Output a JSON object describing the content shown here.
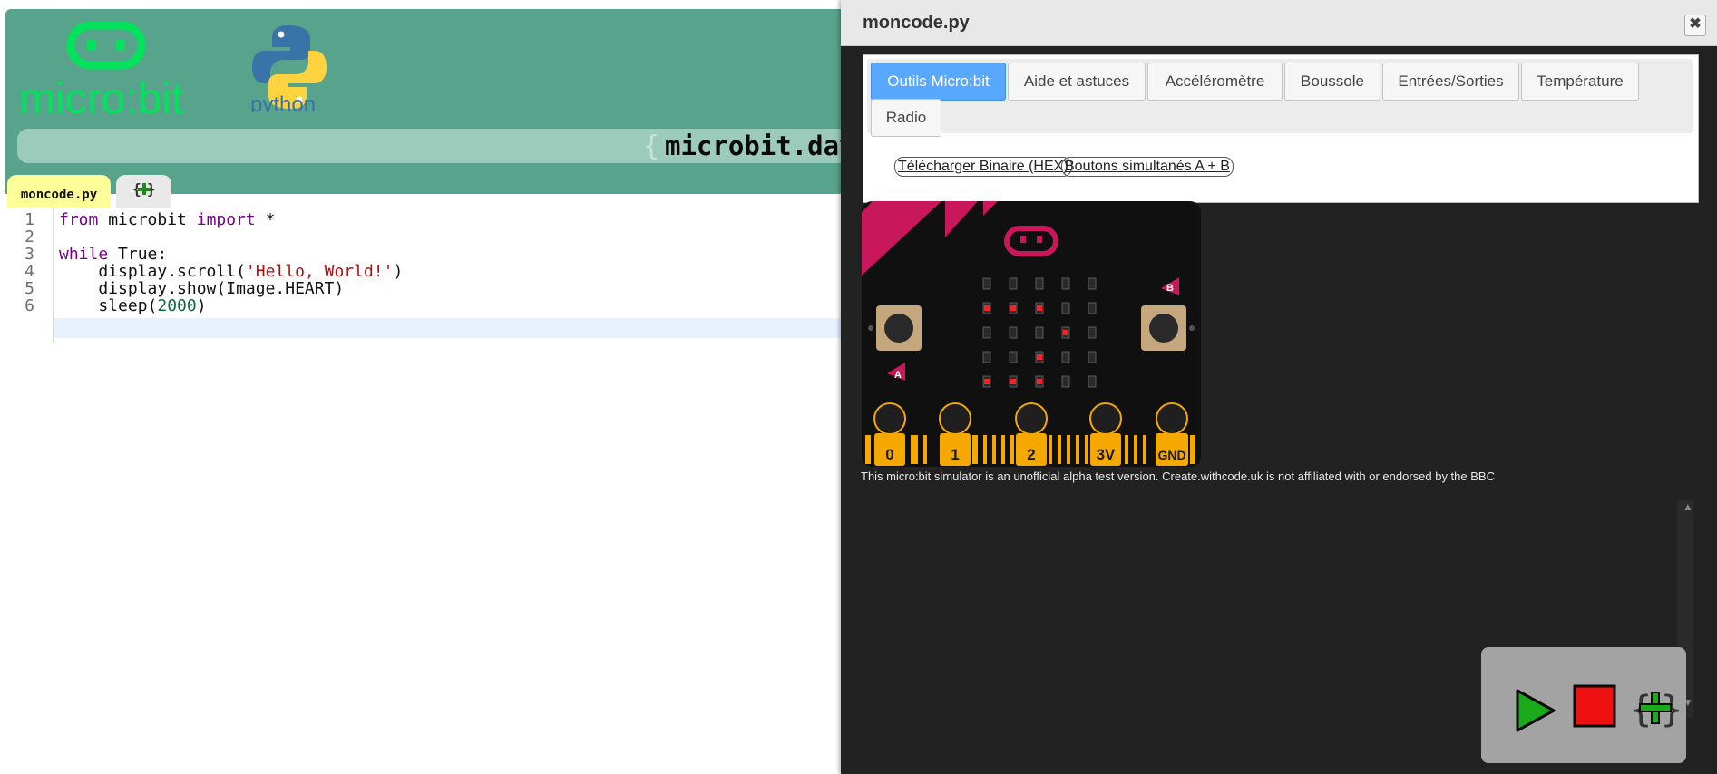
{
  "header": {
    "microbit_logo_text": "micro:bit",
    "python_logo_text": "python",
    "url_brace": "{",
    "url_text": "microbit.dav"
  },
  "editor": {
    "tabs": [
      {
        "label": "moncode.py",
        "active": true
      },
      {
        "label": "add-file",
        "icon": "add-file-icon"
      }
    ],
    "line_numbers": [
      "1",
      "2",
      "3",
      "4",
      "5",
      "6"
    ],
    "active_line": 6,
    "code": {
      "l1_kw1": "from",
      "l1_mid": " microbit ",
      "l1_kw2": "import",
      "l1_end": " *",
      "l3_kw1": "while",
      "l3_mid": " True:",
      "l4_pre": "    display.scroll(",
      "l4_str": "'Hello, World!'",
      "l4_end": ")",
      "l5": "    display.show(Image.HEART)",
      "l6_pre": "    sleep(",
      "l6_num": "2000",
      "l6_end": ")"
    }
  },
  "panel": {
    "title": "moncode.py",
    "close_icon": "close-icon",
    "tabs": [
      {
        "label": "Outils Micro:bit",
        "active": true
      },
      {
        "label": "Aide et astuces"
      },
      {
        "label": "Accéléromètre"
      },
      {
        "label": "Boussole"
      },
      {
        "label": "Entrées/Sorties"
      },
      {
        "label": "Température"
      },
      {
        "label": "Radio"
      }
    ],
    "buttons": {
      "hex": "Télécharger Binaire (HEX)",
      "ab": "Boutons simultanés A + B"
    },
    "board": {
      "button_a": "A",
      "button_b": "B",
      "pins": [
        "0",
        "1",
        "2",
        "3V",
        "GND"
      ],
      "led_matrix": [
        [
          0,
          0,
          0,
          0,
          0
        ],
        [
          1,
          1,
          1,
          0,
          0
        ],
        [
          0,
          0,
          0,
          1,
          0
        ],
        [
          0,
          0,
          1,
          0,
          0
        ],
        [
          1,
          1,
          1,
          0,
          0
        ]
      ]
    },
    "disclaimer": "This micro:bit simulator is an unofficial alpha test version. Create.withcode.uk is not affiliated with or endorsed by the BBC"
  },
  "controls": {
    "run": "play-icon",
    "stop": "stop-icon",
    "new": "add-file-icon"
  },
  "colors": {
    "header": "#58a38c",
    "microbit_green": "#00e35a",
    "active_tab": "#58a8ff",
    "board_accent": "#c8175b",
    "pin_gold": "#f5a800",
    "led_on": "#ff2020"
  }
}
